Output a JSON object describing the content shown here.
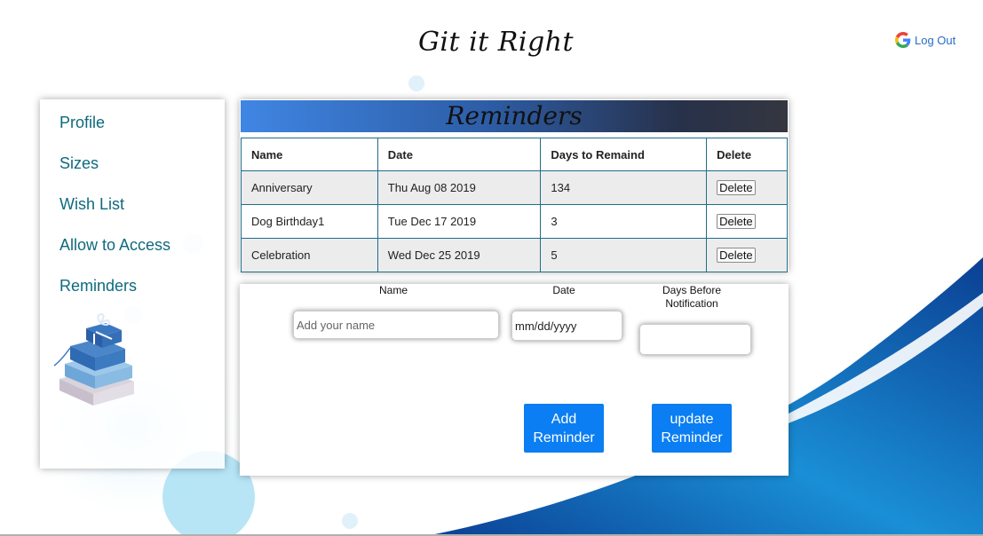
{
  "app": {
    "title": "Git it Right"
  },
  "header": {
    "logout_label": "Log Out",
    "logout_icon": "google-icon"
  },
  "sidebar": {
    "items": [
      {
        "label": "Profile"
      },
      {
        "label": "Sizes"
      },
      {
        "label": "Wish List"
      },
      {
        "label": "Allow to Access"
      },
      {
        "label": "Reminders"
      }
    ],
    "image": "gift-boxes-image"
  },
  "reminders": {
    "title": "Reminders",
    "columns": [
      "Name",
      "Date",
      "Days to Remaind",
      "Delete"
    ],
    "rows": [
      {
        "name": "Anniversary",
        "date": "Thu Aug 08 2019",
        "days": "134",
        "action": "Delete"
      },
      {
        "name": "Dog Birthday1",
        "date": "Tue Dec 17 2019",
        "days": "3",
        "action": "Delete"
      },
      {
        "name": "Celebration",
        "date": "Wed Dec 25 2019",
        "days": "5",
        "action": "Delete"
      }
    ]
  },
  "form": {
    "name_label": "Name",
    "name_placeholder": "Add your name",
    "name_value": "",
    "date_label": "Date",
    "date_value": "mm/dd/yyyy",
    "days_label": "Days Before Notification",
    "days_value": "",
    "add_button": "Add\nReminder",
    "update_button": "update\nReminder"
  },
  "colors": {
    "accent_button": "#0a7ef2",
    "nav_text": "#0e6a7e",
    "table_border": "#1f6d8a",
    "wave_dark": "#0b3f93",
    "wave_light": "#18a8e0"
  }
}
